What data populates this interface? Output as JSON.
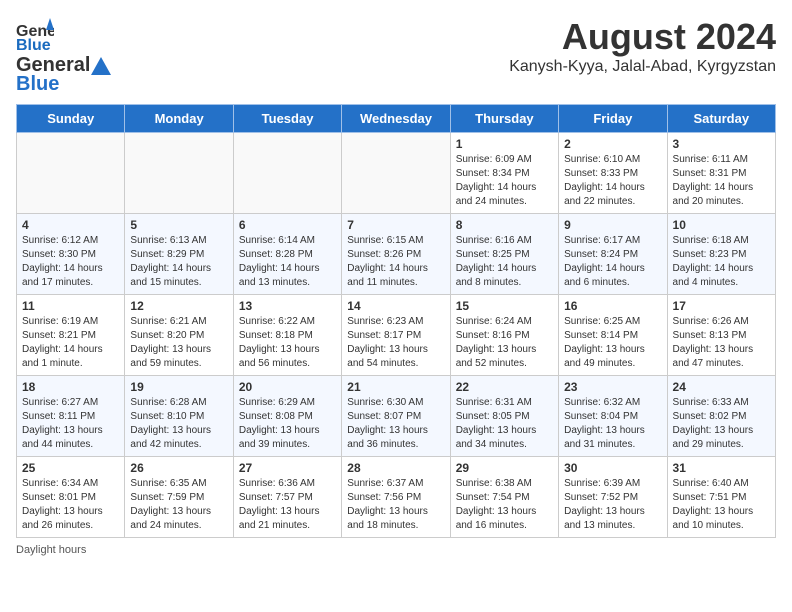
{
  "header": {
    "logo_general": "General",
    "logo_blue": "Blue",
    "title": "August 2024",
    "subtitle": "Kanysh-Kyya, Jalal-Abad, Kyrgyzstan"
  },
  "columns": [
    "Sunday",
    "Monday",
    "Tuesday",
    "Wednesday",
    "Thursday",
    "Friday",
    "Saturday"
  ],
  "weeks": [
    [
      {
        "day": "",
        "info": ""
      },
      {
        "day": "",
        "info": ""
      },
      {
        "day": "",
        "info": ""
      },
      {
        "day": "",
        "info": ""
      },
      {
        "day": "1",
        "info": "Sunrise: 6:09 AM\nSunset: 8:34 PM\nDaylight: 14 hours and 24 minutes."
      },
      {
        "day": "2",
        "info": "Sunrise: 6:10 AM\nSunset: 8:33 PM\nDaylight: 14 hours and 22 minutes."
      },
      {
        "day": "3",
        "info": "Sunrise: 6:11 AM\nSunset: 8:31 PM\nDaylight: 14 hours and 20 minutes."
      }
    ],
    [
      {
        "day": "4",
        "info": "Sunrise: 6:12 AM\nSunset: 8:30 PM\nDaylight: 14 hours and 17 minutes."
      },
      {
        "day": "5",
        "info": "Sunrise: 6:13 AM\nSunset: 8:29 PM\nDaylight: 14 hours and 15 minutes."
      },
      {
        "day": "6",
        "info": "Sunrise: 6:14 AM\nSunset: 8:28 PM\nDaylight: 14 hours and 13 minutes."
      },
      {
        "day": "7",
        "info": "Sunrise: 6:15 AM\nSunset: 8:26 PM\nDaylight: 14 hours and 11 minutes."
      },
      {
        "day": "8",
        "info": "Sunrise: 6:16 AM\nSunset: 8:25 PM\nDaylight: 14 hours and 8 minutes."
      },
      {
        "day": "9",
        "info": "Sunrise: 6:17 AM\nSunset: 8:24 PM\nDaylight: 14 hours and 6 minutes."
      },
      {
        "day": "10",
        "info": "Sunrise: 6:18 AM\nSunset: 8:23 PM\nDaylight: 14 hours and 4 minutes."
      }
    ],
    [
      {
        "day": "11",
        "info": "Sunrise: 6:19 AM\nSunset: 8:21 PM\nDaylight: 14 hours and 1 minute."
      },
      {
        "day": "12",
        "info": "Sunrise: 6:21 AM\nSunset: 8:20 PM\nDaylight: 13 hours and 59 minutes."
      },
      {
        "day": "13",
        "info": "Sunrise: 6:22 AM\nSunset: 8:18 PM\nDaylight: 13 hours and 56 minutes."
      },
      {
        "day": "14",
        "info": "Sunrise: 6:23 AM\nSunset: 8:17 PM\nDaylight: 13 hours and 54 minutes."
      },
      {
        "day": "15",
        "info": "Sunrise: 6:24 AM\nSunset: 8:16 PM\nDaylight: 13 hours and 52 minutes."
      },
      {
        "day": "16",
        "info": "Sunrise: 6:25 AM\nSunset: 8:14 PM\nDaylight: 13 hours and 49 minutes."
      },
      {
        "day": "17",
        "info": "Sunrise: 6:26 AM\nSunset: 8:13 PM\nDaylight: 13 hours and 47 minutes."
      }
    ],
    [
      {
        "day": "18",
        "info": "Sunrise: 6:27 AM\nSunset: 8:11 PM\nDaylight: 13 hours and 44 minutes."
      },
      {
        "day": "19",
        "info": "Sunrise: 6:28 AM\nSunset: 8:10 PM\nDaylight: 13 hours and 42 minutes."
      },
      {
        "day": "20",
        "info": "Sunrise: 6:29 AM\nSunset: 8:08 PM\nDaylight: 13 hours and 39 minutes."
      },
      {
        "day": "21",
        "info": "Sunrise: 6:30 AM\nSunset: 8:07 PM\nDaylight: 13 hours and 36 minutes."
      },
      {
        "day": "22",
        "info": "Sunrise: 6:31 AM\nSunset: 8:05 PM\nDaylight: 13 hours and 34 minutes."
      },
      {
        "day": "23",
        "info": "Sunrise: 6:32 AM\nSunset: 8:04 PM\nDaylight: 13 hours and 31 minutes."
      },
      {
        "day": "24",
        "info": "Sunrise: 6:33 AM\nSunset: 8:02 PM\nDaylight: 13 hours and 29 minutes."
      }
    ],
    [
      {
        "day": "25",
        "info": "Sunrise: 6:34 AM\nSunset: 8:01 PM\nDaylight: 13 hours and 26 minutes."
      },
      {
        "day": "26",
        "info": "Sunrise: 6:35 AM\nSunset: 7:59 PM\nDaylight: 13 hours and 24 minutes."
      },
      {
        "day": "27",
        "info": "Sunrise: 6:36 AM\nSunset: 7:57 PM\nDaylight: 13 hours and 21 minutes."
      },
      {
        "day": "28",
        "info": "Sunrise: 6:37 AM\nSunset: 7:56 PM\nDaylight: 13 hours and 18 minutes."
      },
      {
        "day": "29",
        "info": "Sunrise: 6:38 AM\nSunset: 7:54 PM\nDaylight: 13 hours and 16 minutes."
      },
      {
        "day": "30",
        "info": "Sunrise: 6:39 AM\nSunset: 7:52 PM\nDaylight: 13 hours and 13 minutes."
      },
      {
        "day": "31",
        "info": "Sunrise: 6:40 AM\nSunset: 7:51 PM\nDaylight: 13 hours and 10 minutes."
      }
    ]
  ],
  "footer": {
    "daylight_hours": "Daylight hours"
  }
}
